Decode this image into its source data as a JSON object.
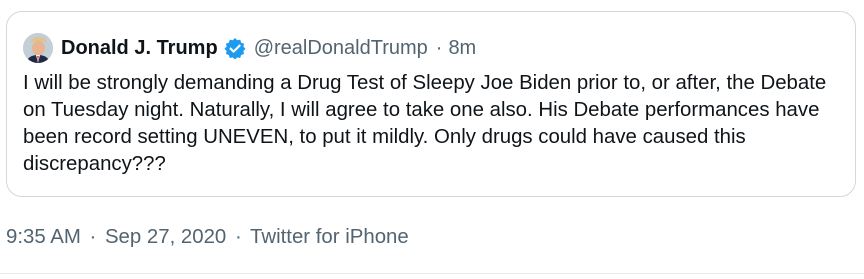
{
  "tweet": {
    "author_name": "Donald J. Trump",
    "handle": "@realDonaldTrump",
    "separator": "·",
    "relative_time": "8m",
    "avatar_icon": "profile-photo",
    "verified_icon": "verified-badge-icon",
    "text": "I will be strongly demanding a Drug Test of Sleepy Joe Biden prior to, or after, the Debate on Tuesday night. Naturally, I will agree to take one also. His Debate performances have been record setting UNEVEN, to put it mildly. Only drugs could have caused this discrepancy???"
  },
  "meta": {
    "time": "9:35 AM",
    "separator": "·",
    "date": "Sep 27, 2020",
    "source": "Twitter for iPhone"
  },
  "colors": {
    "text": "#0f1419",
    "secondary": "#536471",
    "verified": "#1d9bf0",
    "border": "#cfd9de"
  }
}
